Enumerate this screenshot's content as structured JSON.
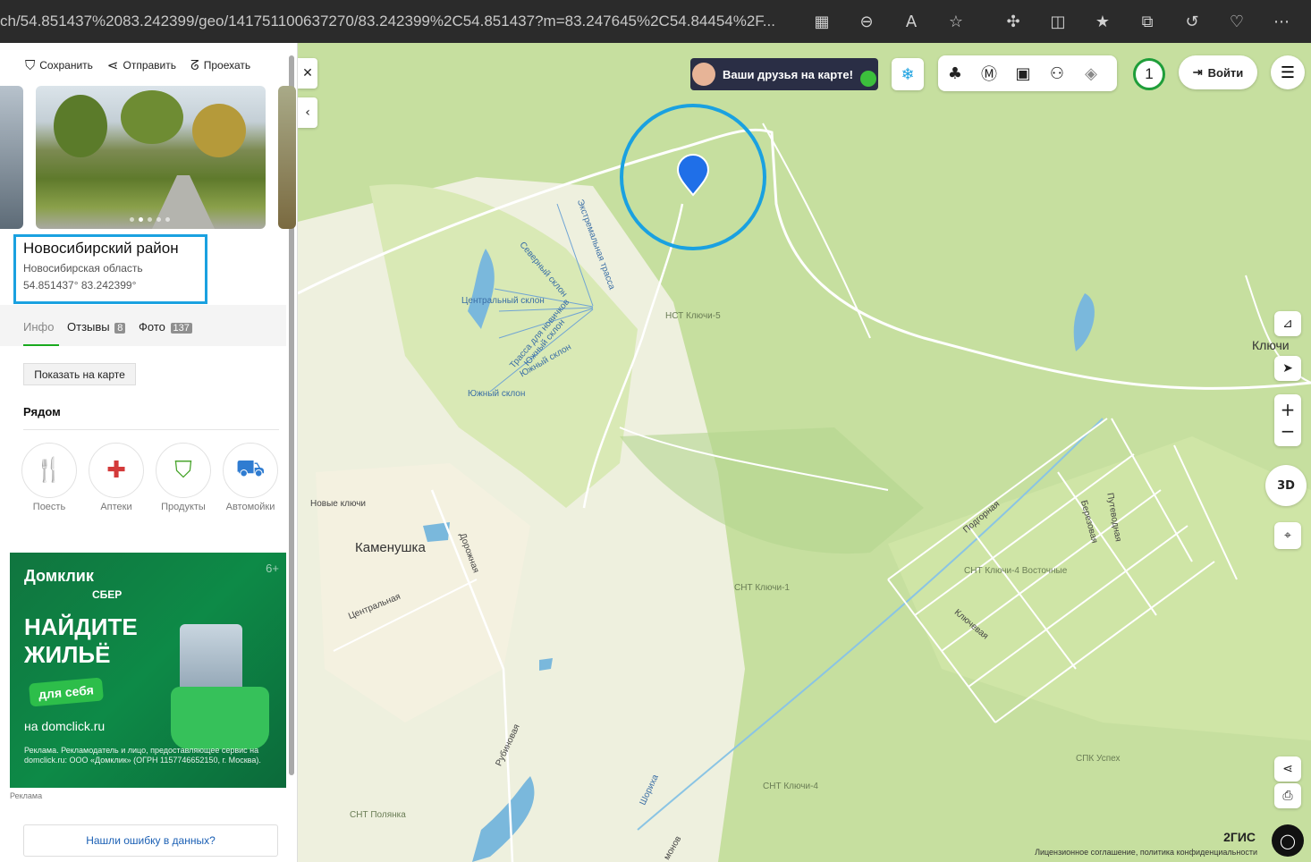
{
  "browser": {
    "url": "ch/54.851437%2083.242399/geo/141751100637270/83.242399%2C54.851437?m=83.247645%2C54.84454%2F..."
  },
  "panel": {
    "actions": [
      {
        "icon": "bookmark-icon",
        "label": "Сохранить"
      },
      {
        "icon": "share-icon",
        "label": "Отправить"
      },
      {
        "icon": "route-icon",
        "label": "Проехать"
      }
    ],
    "title": "Новосибирский район",
    "subtitle": "Новосибирская область",
    "coordinates": "54.851437° 83.242399°",
    "tabs": [
      {
        "label": "Инфо",
        "badge": ""
      },
      {
        "label": "Отзывы",
        "badge": "8"
      },
      {
        "label": "Фото",
        "badge": "137"
      }
    ],
    "show_on_map": "Показать на карте",
    "nearby_title": "Рядом",
    "nearby": [
      {
        "icon": "fork-knife-icon",
        "label": "Поесть",
        "color": "#e58a1f"
      },
      {
        "icon": "pharmacy-icon",
        "label": "Аптеки",
        "color": "#d33a3a"
      },
      {
        "icon": "basket-icon",
        "label": "Продукты",
        "color": "#4aa52e"
      },
      {
        "icon": "car-icon",
        "label": "Автомойки",
        "color": "#2f7cd1"
      }
    ],
    "ad": {
      "brand": "Домклик",
      "brand_sub": "СБЕР",
      "age": "6+",
      "headline": "НАЙДИТЕ ЖИЛЬЁ",
      "pill": "для себя",
      "site": "на domclick.ru",
      "legal": "Реклама. Рекламодатель и лицо, предоставляющее сервис на domclick.ru: ООО «Домклик» (ОГРН 1157746652150, г. Москва)."
    },
    "ad_label": "Реклама",
    "error_button": "Нашли ошибку в данных?"
  },
  "map": {
    "friends_banner": "Ваши друзья на карте!",
    "login": "Войти",
    "counter": "1",
    "labels": {
      "nst_klyuchi5": "НСТ Ключи-5",
      "klyuchi": "Ключи",
      "snt_klyuchi1": "СНТ Ключи-1",
      "snt_klyuchi4v": "СНТ Ключи-4 Восточные",
      "snt_klyuchi4": "СНТ Ключи-4",
      "spk_uspeh": "СПК Успех",
      "snt_polyanka": "СНТ Полянка",
      "novye_klyuchi": "Новые ключи",
      "kamenushka": "Каменушка",
      "dorozhnaya": "Дорожная",
      "centralnaya": "Центральная",
      "rubinovaya": "Рубиновая",
      "shiriha": "Шориха",
      "podgornaya": "Подгорная",
      "berezovaya": "Березовая",
      "putevodnaya": "Путеводная",
      "klyuchevaya": "Ключевая",
      "ekstr": "Экстремальная трасса",
      "severny": "Северный склон",
      "centralny": "Центральный склон",
      "novichki": "Трасса для новичков",
      "yuzhny1": "Южный склон",
      "yuzhny2": "Южный склон",
      "yuzhny3": "Южный склон",
      "monov": "монов"
    },
    "brand": "2ГИС",
    "license": "Лицензионное соглашение, политика конфиденциальности",
    "zoom_3d": "3D"
  }
}
